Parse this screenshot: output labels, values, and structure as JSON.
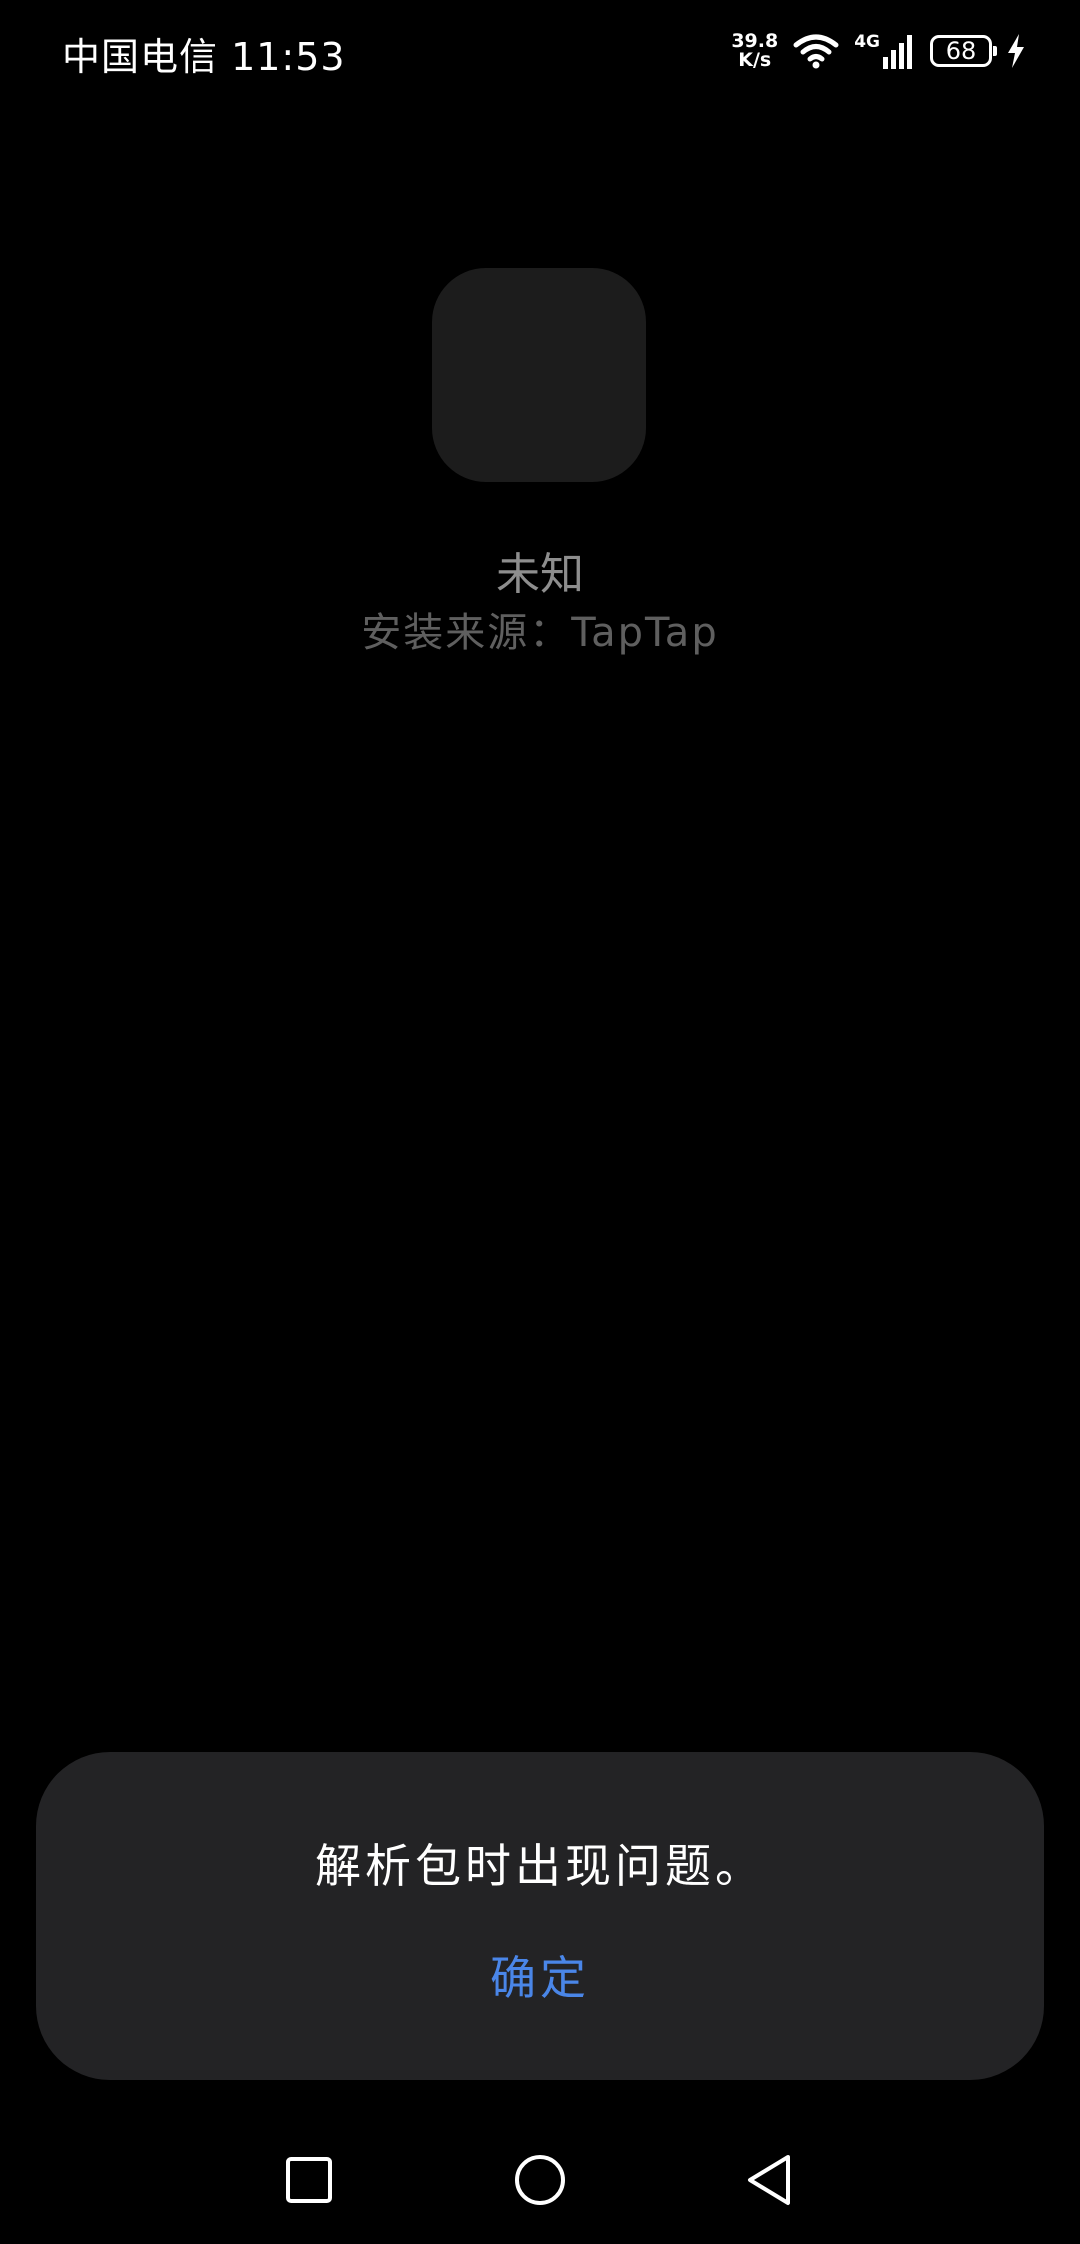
{
  "status_bar": {
    "carrier_time": "中国电信 11:53",
    "net_speed_value": "39.8",
    "net_speed_unit": "K/s",
    "network_type": "4G",
    "battery_level": "68"
  },
  "app": {
    "name": "未知",
    "install_source": "安装来源：TapTap"
  },
  "dialog": {
    "message": "解析包时出现问题。",
    "confirm_label": "确定"
  },
  "colors": {
    "background": "#000000",
    "dialog_bg": "#232325",
    "accent": "#4a86e8"
  },
  "nav_bar": {
    "icons": [
      "recent-apps-icon",
      "home-icon",
      "back-icon"
    ]
  }
}
